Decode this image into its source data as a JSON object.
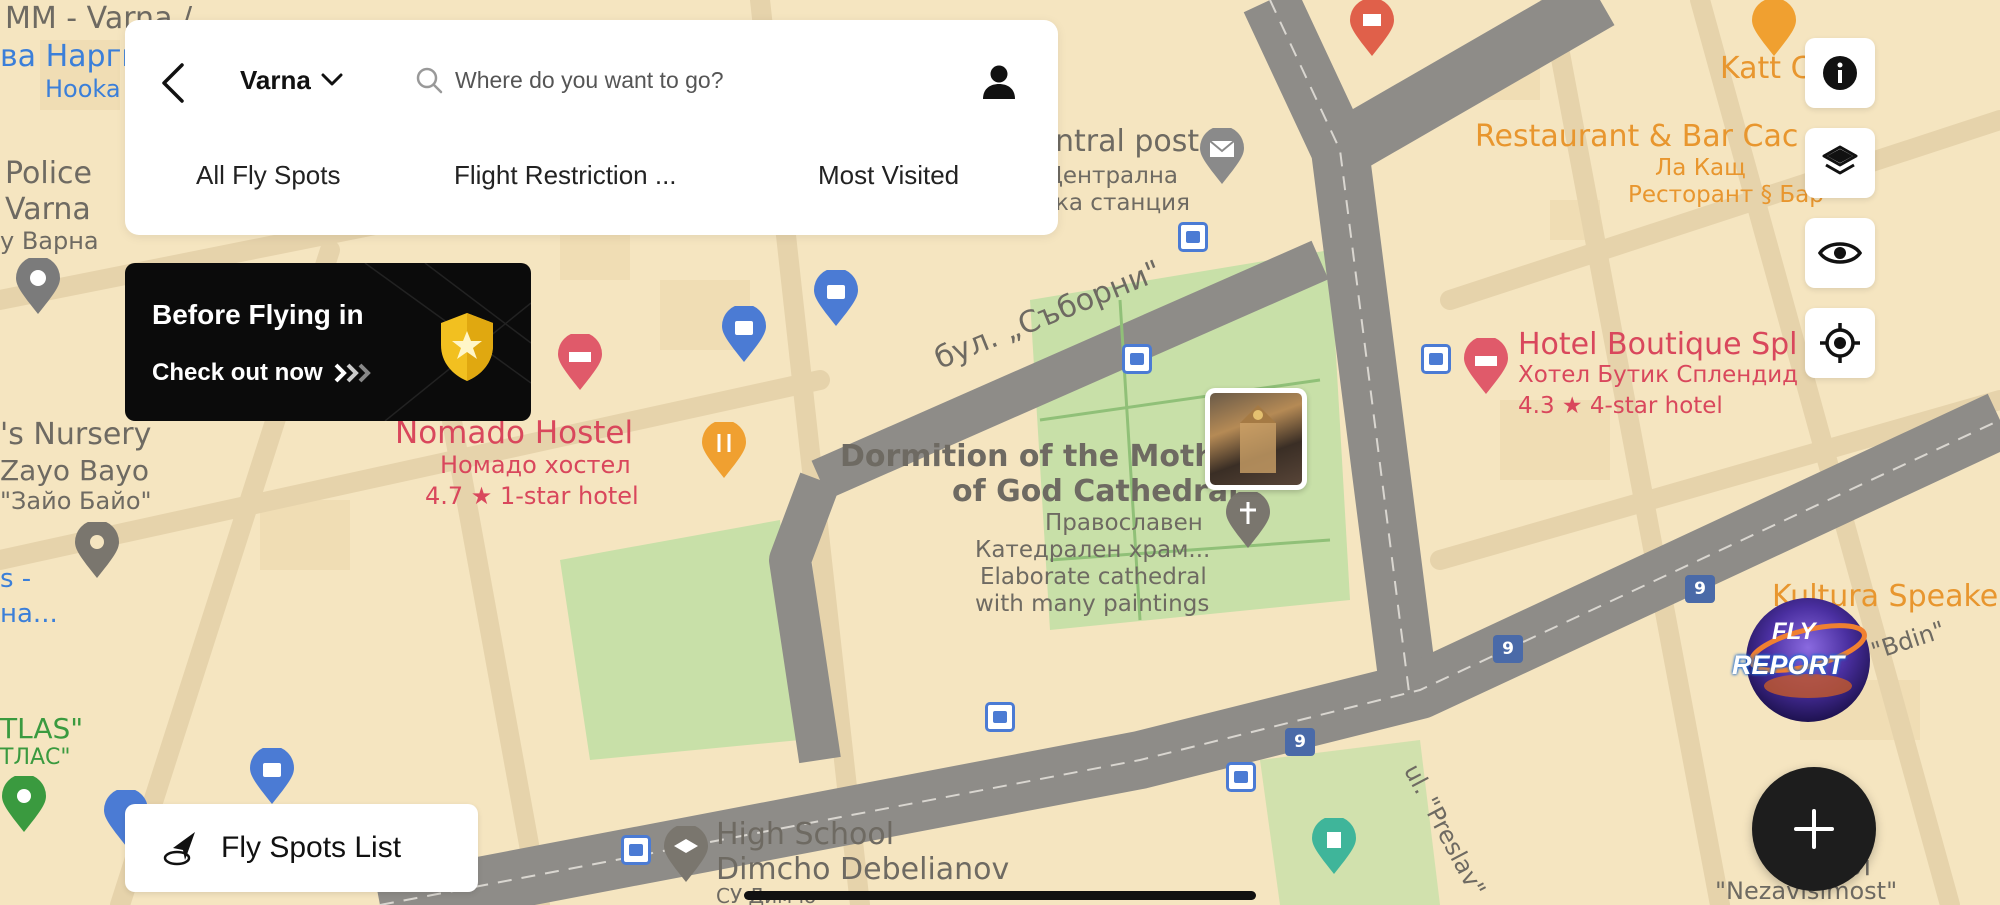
{
  "header": {
    "city": "Varna",
    "search_placeholder": "Where do you want to go?",
    "tabs": [
      "All Fly Spots",
      "Flight Restriction ...",
      "Most Visited"
    ]
  },
  "promo": {
    "title": "Before Flying in",
    "subtitle": "Check out now"
  },
  "buttons": {
    "fly_spots_list": "Fly Spots List",
    "fly_report_line1": "FLY",
    "fly_report_line2": "REPORT"
  },
  "map_labels": {
    "mm_varna": "MM - Varna /",
    "va_narg": "ва Нарги",
    "hooka": "Hooka",
    "police": "Police",
    "police_varna": "Varna",
    "police_cyr": "у Варна",
    "nursery": "'s Nursery",
    "zayo": "Zayo Bayo",
    "zayo_cyr": "\"Зайо Байо\"",
    "s_dash": "s -",
    "na": "на...",
    "atlas": "TLAS\"",
    "atlas_cyr": "ТЛАС\"",
    "central_post": "ntral post",
    "central_post_cyr1": "Централна",
    "central_post_cyr2": "ка станция",
    "bul_saborni": "бул. „Съборни\"",
    "nomado": "Nomado Hostel",
    "nomado_cyr": "Номадо хостел",
    "nomado_rating": "4.7 ★ 1-star hotel",
    "cathedral1": "Dormition of the Mother",
    "cathedral2": "of God Cathedral",
    "cathedral_cyr1": "Православен",
    "cathedral_cyr2": "Катедрален храм...",
    "cathedral_desc1": "Elaborate cathedral",
    "cathedral_desc2": "with many paintings",
    "katt": "Katt C",
    "restaurant": "Restaurant & Bar Cac",
    "restaurant_cyr1": "Ла Кащ",
    "restaurant_cyr2": "Ресторант § Бар",
    "hotel": "Hotel Boutique Spl nd",
    "hotel_cyr": "Хотел Бутик Сплендид",
    "hotel_rating": "4.3 ★ 4-star hotel",
    "kultura": "Kultura Speake",
    "bdin": "\"Bdin\"",
    "preslav": "ul. \"Preslav\"",
    "school1": "High School",
    "school2": "Dimcho Debelianov",
    "school3": "СУ Димчо",
    "nezav1": "Пл",
    "nezav2": "\"Nezavisimost\"",
    "route9a": "9",
    "route9b": "9",
    "route9c": "9"
  },
  "colors": {
    "map_bg": "#f5e5c0",
    "road": "#8e8c88",
    "park": "#c8e0a8",
    "poi_red": "#e05a6a",
    "poi_blue": "#4b7bd4",
    "poi_orange": "#f0a030",
    "panel": "#ffffff",
    "dark": "#111111"
  },
  "icons": {
    "back": "chevron-left-icon",
    "dropdown": "chevron-down-icon",
    "search": "search-icon",
    "user": "user-icon",
    "info": "info-icon",
    "layers": "layers-icon",
    "eye": "eye-icon",
    "locate": "crosshair-icon",
    "add": "plus-icon",
    "drone": "drone-icon",
    "shield": "shield-star-icon"
  }
}
